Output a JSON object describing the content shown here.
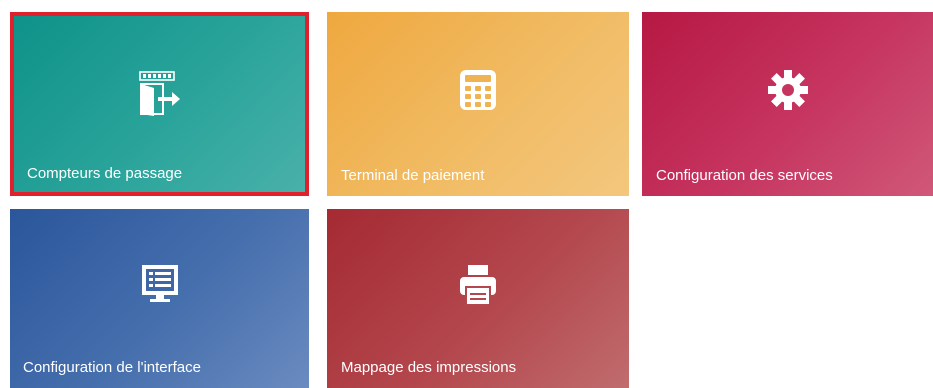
{
  "tiles": [
    {
      "label": "Compteurs de passage",
      "icon": "counter-exit-icon",
      "color": "#1a9a91",
      "selected": true
    },
    {
      "label": "Terminal de paiement",
      "icon": "calculator-icon",
      "color": "#f0b352"
    },
    {
      "label": "Configuration des services",
      "icon": "gear-icon",
      "color": "#c32a55"
    },
    {
      "label": "Configuration de l'interface",
      "icon": "monitor-list-icon",
      "color": "#3c65a8"
    },
    {
      "label": "Mappage des impressions",
      "icon": "printer-icon",
      "color": "#ad3a40"
    }
  ]
}
